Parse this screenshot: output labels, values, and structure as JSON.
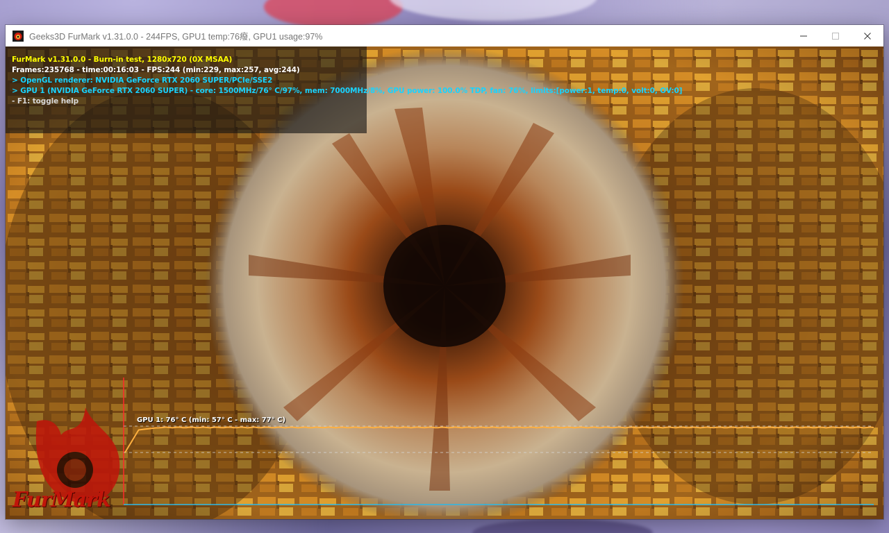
{
  "window": {
    "title": "Geeks3D FurMark v1.31.0.0 - 244FPS, GPU1 temp:76癈, GPU1 usage:97%",
    "icon": "furmark-app-icon",
    "controls": [
      "minimize-icon",
      "maximize-icon",
      "close-icon"
    ]
  },
  "hud": {
    "line1": "FurMark v1.31.0.0 - Burn-in test, 1280x720 (0X MSAA)",
    "line2": "Frames:235768 - time:00:16:03 - FPS:244 (min:229, max:257, avg:244)",
    "line3": "> OpenGL renderer: NVIDIA GeForce RTX 2060 SUPER/PCIe/SSE2",
    "line4": "> GPU 1 (NVIDIA GeForce RTX 2060 SUPER) - core: 1500MHz/76° C/97%, mem: 7000MHz/8%, GPU power: 100.0% TDP, fan: 76%, limits:[power:1, temp:0, volt:0, OV:0]",
    "line5": "- F1: toggle help",
    "colors": {
      "line1": "#ffff00",
      "line2": "#ffffff",
      "line3": "#19d3ff",
      "line4": "#19d3ff",
      "line5": "#d8d8d8"
    }
  },
  "temperature_graph": {
    "label": "GPU 1: 76° C (min: 57° C - max: 77° C)",
    "current": 76,
    "min": 57,
    "max": 77,
    "unit": "° C",
    "line_color": "#ffb040",
    "axis_color": "#2ab8e8",
    "marker_color": "#ff2a2a"
  },
  "logo": {
    "text": "FurMark"
  }
}
